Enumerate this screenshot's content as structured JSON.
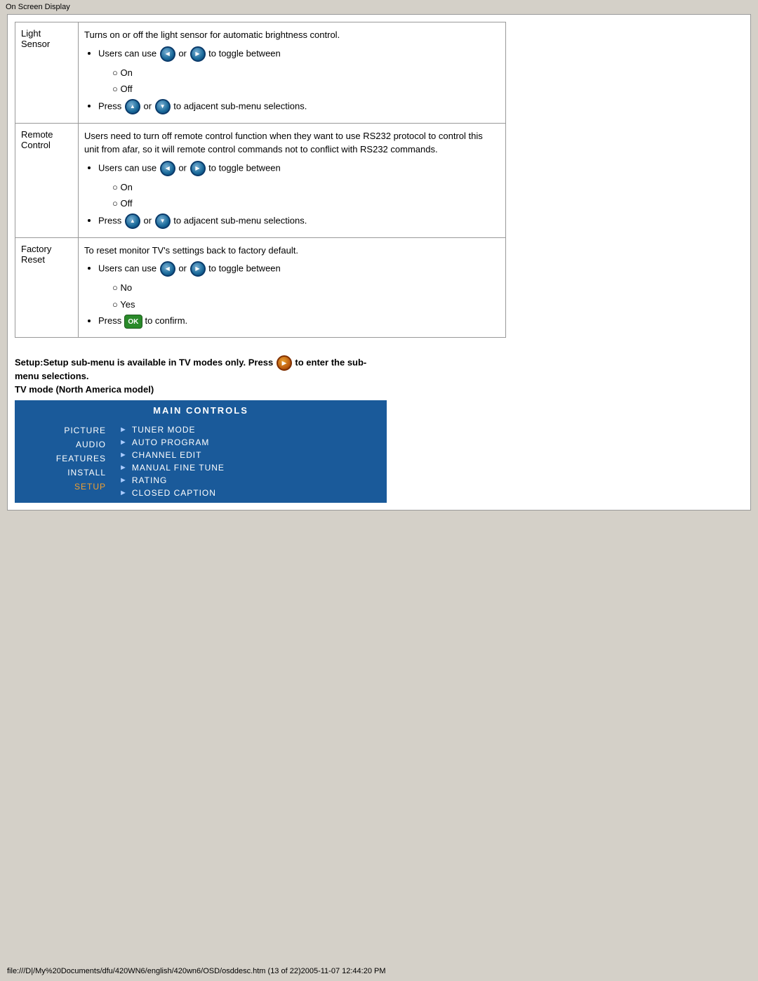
{
  "browser": {
    "address_bar": "On Screen Display"
  },
  "light_sensor": {
    "label": "Light\nSensor",
    "description": "Turns on or off the light sensor for automatic brightness control.",
    "toggle_text": "Users can use",
    "toggle_between": "to toggle between",
    "options": [
      "On",
      "Off"
    ],
    "press_text": "Press",
    "press_action": "to adjacent sub-menu selections."
  },
  "remote_control": {
    "label": "Remote\nControl",
    "description": "Users need to turn off remote control function when they want to use RS232 protocol to control this unit from afar, so it will remote control commands not to conflict with RS232 commands.",
    "toggle_text": "Users can use",
    "toggle_between": "to toggle between",
    "options": [
      "On",
      "Off"
    ],
    "press_text": "Press",
    "press_action": "to adjacent sub-menu selections."
  },
  "factory_reset": {
    "label": "Factory\nReset",
    "description": "To reset monitor TV's settings back to factory default.",
    "toggle_text": "Users can use",
    "toggle_between": "to toggle between",
    "options": [
      "No",
      "Yes"
    ],
    "press_text": "Press",
    "press_action": "to confirm."
  },
  "setup_note": {
    "line1": "Setup:Setup sub-menu is available in TV modes only. Press",
    "line2": "to enter the sub-menu selections.",
    "tv_mode_title": "TV mode (North America model)"
  },
  "menu": {
    "header": "MAIN  CONTROLS",
    "left_items": [
      "PICTURE",
      "AUDIO",
      "FEATURES",
      "INSTALL",
      "SETUP"
    ],
    "active_item": "SETUP",
    "right_items": [
      "TUNER MODE",
      "AUTO PROGRAM",
      "CHANNEL EDIT",
      "MANUAL FINE TUNE",
      "RATING",
      "CLOSED CAPTION"
    ]
  },
  "footer": {
    "text": "file:///D|/My%20Documents/dfu/420WN6/english/420wn6/OSD/osddesc.htm (13 of 22)2005-11-07 12:44:20 PM"
  },
  "buttons": {
    "left": "◀",
    "right": "▶",
    "up": "▲",
    "down": "▼",
    "ok": "OK"
  }
}
